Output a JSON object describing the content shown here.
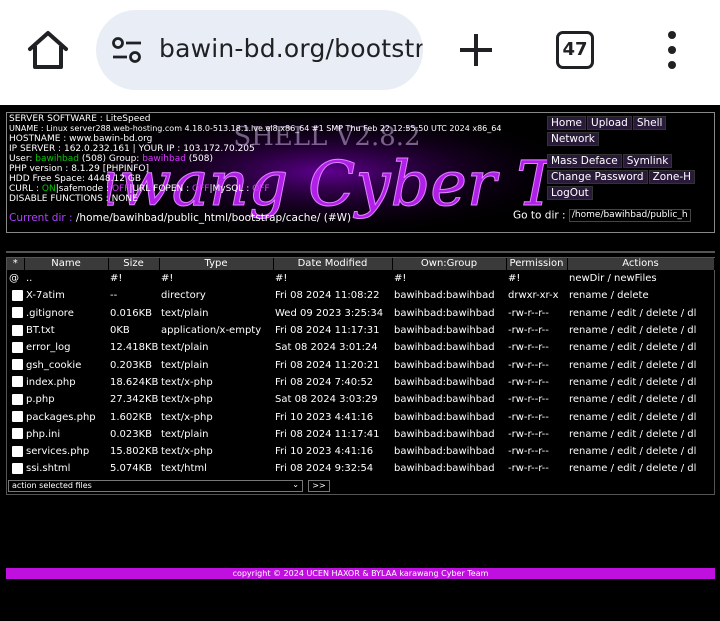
{
  "browser": {
    "url": "bawin-bd.org/bootstrap",
    "tab_count": "47"
  },
  "banner": {
    "title": "Karawang Cyber Team",
    "version": "SHELL V2.8.2"
  },
  "server_info": {
    "software_label": "SERVER SOFTWARE : ",
    "software": "LiteSpeed",
    "uname_label": "UNAME : ",
    "uname": "Linux server288.web-hosting.com 4.18.0-513.18.1.lve.el8.x86_64 #1 SMP Thu Feb 22 12:55:50 UTC 2024 x86_64",
    "hostname_label": "HOSTNAME : ",
    "hostname": "www.bawin-bd.org",
    "ip_label": "IP SERVER : ",
    "ip": "162.0.232.161 | YOUR IP : 103.172.70.205",
    "user_label": "User: ",
    "user": "bawihbad",
    "user_uid": " (508) Group: ",
    "group": "bawihbad",
    "group_gid": " (508)",
    "php_label": "PHP version : ",
    "php": "8.1.29 [PHPINFO]",
    "hdd_label": "HDD Free Space: ",
    "hdd": "4448.12 GB",
    "curl_label": "CURL : ",
    "curl": "ON",
    "safemode_label": "|safemode : ",
    "safemode": "OFF",
    "urlfopen_label": "|URL FOPEN : ",
    "urlfopen": "OFF",
    "mysql_label": "|MySQL : ",
    "mysql": "OFF",
    "disable_label": "DISABLE FUNCTIONS : ",
    "disable": "NONE"
  },
  "current_dir": {
    "label": "Current dir : ",
    "path": "/home/bawihbad/public_html/bootstrap/cache/",
    "perm": " (#W)"
  },
  "nav": {
    "home": "Home",
    "upload": "Upload",
    "shell": "Shell",
    "network": "Network",
    "mass_deface": "Mass Deface",
    "symlink": "Symlink",
    "change_password": "Change Password",
    "zone_h": "Zone-H",
    "logout": "LogOut"
  },
  "goto": {
    "label": "Go to dir : ",
    "value": "/home/bawihbad/public_h"
  },
  "table": {
    "headers": [
      "*",
      "Name",
      "Size",
      "Type",
      "Date Modified",
      "Own:Group",
      "Permission",
      "Actions"
    ],
    "parent_row": {
      "sel": "@",
      "name": "..",
      "size": "#!",
      "type": "#!",
      "date": "#!",
      "own": "#!",
      "perm": "#!",
      "actions": "newDir / newFiles"
    },
    "rows": [
      {
        "name": "X-7atim",
        "size": "--",
        "type": "directory",
        "date": "Fri 08 2024 11:08:22",
        "own": "bawihbad:bawihbad",
        "perm": "drwxr-xr-x",
        "actions": "rename / delete"
      },
      {
        "name": ".gitignore",
        "size": "0.016KB",
        "type": "text/plain",
        "date": "Wed 09 2023 3:25:34",
        "own": "bawihbad:bawihbad",
        "perm": "-rw-r--r--",
        "actions": "rename / edit / delete / dl"
      },
      {
        "name": "BT.txt",
        "size": "0KB",
        "type": "application/x-empty",
        "date": "Fri 08 2024 11:17:31",
        "own": "bawihbad:bawihbad",
        "perm": "-rw-r--r--",
        "actions": "rename / edit / delete / dl"
      },
      {
        "name": "error_log",
        "size": "12.418KB",
        "type": "text/plain",
        "date": "Sat 08 2024 3:01:24",
        "own": "bawihbad:bawihbad",
        "perm": "-rw-r--r--",
        "actions": "rename / edit / delete / dl"
      },
      {
        "name": "gsh_cookie",
        "size": "0.203KB",
        "type": "text/plain",
        "date": "Fri 08 2024 11:20:21",
        "own": "bawihbad:bawihbad",
        "perm": "-rw-r--r--",
        "actions": "rename / edit / delete / dl"
      },
      {
        "name": "index.php",
        "size": "18.624KB",
        "type": "text/x-php",
        "date": "Fri 08 2024 7:40:52",
        "own": "bawihbad:bawihbad",
        "perm": "-rw-r--r--",
        "actions": "rename / edit / delete / dl"
      },
      {
        "name": "p.php",
        "size": "27.342KB",
        "type": "text/x-php",
        "date": "Sat 08 2024 3:03:29",
        "own": "bawihbad:bawihbad",
        "perm": "-rw-r--r--",
        "actions": "rename / edit / delete / dl"
      },
      {
        "name": "packages.php",
        "size": "1.602KB",
        "type": "text/x-php",
        "date": "Fri 10 2023 4:41:16",
        "own": "bawihbad:bawihbad",
        "perm": "-rw-r--r--",
        "actions": "rename / edit / delete / dl"
      },
      {
        "name": "php.ini",
        "size": "0.023KB",
        "type": "text/plain",
        "date": "Fri 08 2024 11:17:41",
        "own": "bawihbad:bawihbad",
        "perm": "-rw-r--r--",
        "actions": "rename / edit / delete / dl"
      },
      {
        "name": "services.php",
        "size": "15.802KB",
        "type": "text/x-php",
        "date": "Fri 10 2023 4:41:16",
        "own": "bawihbad:bawihbad",
        "perm": "-rw-r--r--",
        "actions": "rename / edit / delete / dl"
      },
      {
        "name": "ssi.shtml",
        "size": "5.074KB",
        "type": "text/html",
        "date": "Fri 08 2024 9:32:54",
        "own": "bawihbad:bawihbad",
        "perm": "-rw-r--r--",
        "actions": "rename / edit / delete / dl"
      }
    ]
  },
  "bulk": {
    "select_value": "action selected files",
    "go_label": ">>"
  },
  "footer": {
    "text": "copyright © 2024 UCEN HAXOR & BYLAA karawang Cyber Team"
  },
  "colors": {
    "accent": "#c010e0",
    "header_row": "#3a3a3a",
    "green": "#00c800"
  }
}
